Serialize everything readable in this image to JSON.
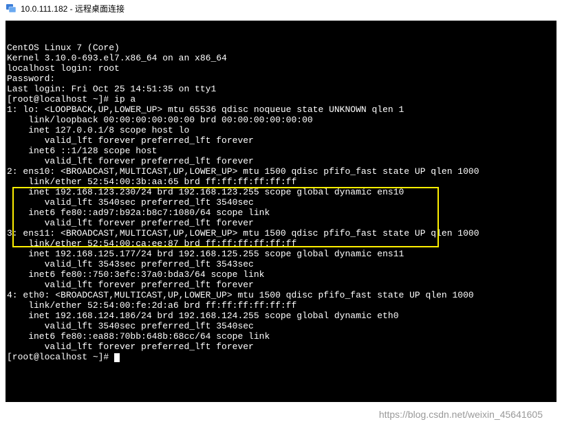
{
  "window": {
    "title": "10.0.111.182 - 远程桌面连接"
  },
  "terminal": {
    "lines": [
      "CentOS Linux 7 (Core)",
      "Kernel 3.10.0-693.el7.x86_64 on an x86_64",
      "",
      "localhost login: root",
      "Password:",
      "Last login: Fri Oct 25 14:51:35 on tty1",
      "[root@localhost ~]# ip a",
      "1: lo: <LOOPBACK,UP,LOWER_UP> mtu 65536 qdisc noqueue state UNKNOWN qlen 1",
      "    link/loopback 00:00:00:00:00:00 brd 00:00:00:00:00:00",
      "    inet 127.0.0.1/8 scope host lo",
      "       valid_lft forever preferred_lft forever",
      "    inet6 ::1/128 scope host",
      "       valid_lft forever preferred_lft forever",
      "2: ens10: <BROADCAST,MULTICAST,UP,LOWER_UP> mtu 1500 qdisc pfifo_fast state UP qlen 1000",
      "    link/ether 52:54:00:3b:aa:65 brd ff:ff:ff:ff:ff:ff",
      "    inet 192.168.123.230/24 brd 192.168.123.255 scope global dynamic ens10",
      "       valid_lft 3540sec preferred_lft 3540sec",
      "    inet6 fe80::ad97:b92a:b8c7:1080/64 scope link",
      "       valid_lft forever preferred_lft forever",
      "3: ens11: <BROADCAST,MULTICAST,UP,LOWER_UP> mtu 1500 qdisc pfifo_fast state UP qlen 1000",
      "    link/ether 52:54:00:ca:ee:87 brd ff:ff:ff:ff:ff:ff",
      "    inet 192.168.125.177/24 brd 192.168.125.255 scope global dynamic ens11",
      "       valid_lft 3543sec preferred_lft 3543sec",
      "    inet6 fe80::750:3efc:37a0:bda3/64 scope link",
      "       valid_lft forever preferred_lft forever",
      "4: eth0: <BROADCAST,MULTICAST,UP,LOWER_UP> mtu 1500 qdisc pfifo_fast state UP qlen 1000",
      "    link/ether 52:54:00:fe:2d:a6 brd ff:ff:ff:ff:ff:ff",
      "    inet 192.168.124.186/24 brd 192.168.124.255 scope global dynamic eth0",
      "       valid_lft 3540sec preferred_lft 3540sec",
      "    inet6 fe80::ea88:70bb:648b:68cc/64 scope link",
      "       valid_lft forever preferred_lft forever",
      "[root@localhost ~]# "
    ]
  },
  "watermark": "https://blog.csdn.net/weixin_45641605"
}
